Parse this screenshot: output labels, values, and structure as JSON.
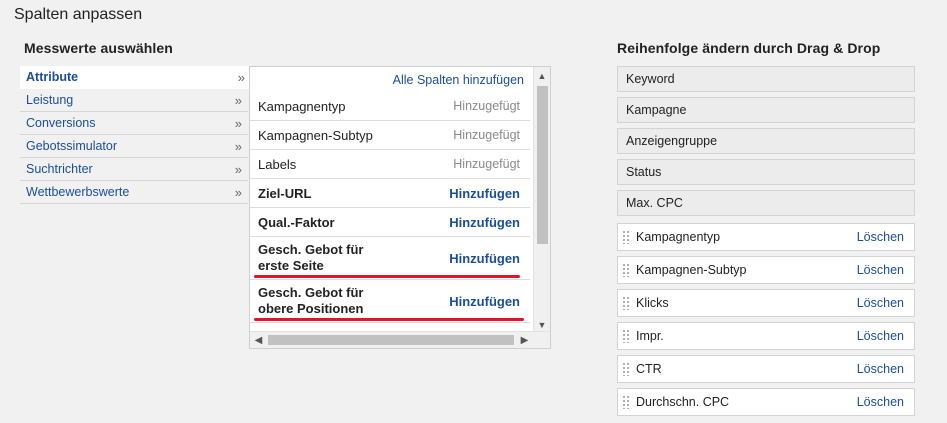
{
  "page": {
    "title": "Spalten anpassen"
  },
  "left": {
    "heading": "Messwerte auswählen",
    "categories": [
      {
        "label": "Attribute",
        "chevron": "»"
      },
      {
        "label": "Leistung",
        "chevron": "»"
      },
      {
        "label": "Conversions",
        "chevron": "»"
      },
      {
        "label": "Gebotssimulator",
        "chevron": "»"
      },
      {
        "label": "Suchtrichter",
        "chevron": "»"
      },
      {
        "label": "Wettbewerbswerte",
        "chevron": "»"
      }
    ]
  },
  "metrics": {
    "add_all": "Alle Spalten hinzufügen",
    "rows": [
      {
        "label": "Kampagnentyp",
        "action": "Hinzugefügt"
      },
      {
        "label": "Kampagnen-Subtyp",
        "action": "Hinzugefügt"
      },
      {
        "label": "Labels",
        "action": "Hinzugefügt"
      },
      {
        "label": "Ziel-URL",
        "action": "Hinzufügen"
      },
      {
        "label": "Qual.-Faktor",
        "action": "Hinzufügen"
      },
      {
        "label_line1": "Gesch. Gebot für",
        "label_line2": "erste Seite",
        "action": "Hinzufügen"
      },
      {
        "label_line1": "Gesch. Gebot für",
        "label_line2": "obere Positionen",
        "action": "Hinzufügen"
      }
    ]
  },
  "right": {
    "heading": "Reihenfolge ändern durch Drag & Drop",
    "fixed_columns": [
      "Keyword",
      "Kampagne",
      "Anzeigengruppe",
      "Status",
      "Max. CPC"
    ],
    "draggable_columns": [
      {
        "label": "Kampagnentyp",
        "action": "Löschen"
      },
      {
        "label": "Kampagnen-Subtyp",
        "action": "Löschen"
      },
      {
        "label": "Klicks",
        "action": "Löschen"
      },
      {
        "label": "Impr.",
        "action": "Löschen"
      },
      {
        "label": "CTR",
        "action": "Löschen"
      },
      {
        "label": "Durchschn. CPC",
        "action": "Löschen"
      }
    ]
  },
  "icons": {
    "scroll_up": "▲",
    "scroll_down": "▼",
    "scroll_left": "◀",
    "scroll_right": "▶",
    "grip": "drag-handle-icon"
  },
  "colors": {
    "link": "#1a4e9d",
    "highlight": "#e0152a",
    "muted": "#8a8a8a"
  }
}
